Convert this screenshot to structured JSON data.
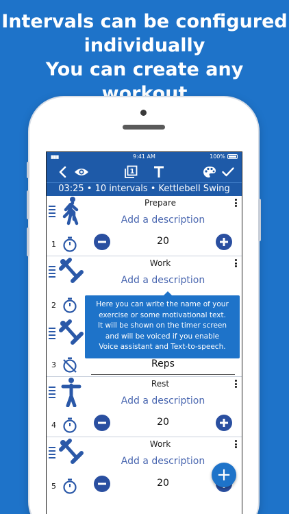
{
  "headline": {
    "line1": "Intervals can be configured",
    "line2": "individually",
    "line3": "You can create any workout"
  },
  "status_bar": {
    "time": "9:41 AM",
    "battery": "100%"
  },
  "toolbar": {
    "icons": [
      "back-icon",
      "eye-icon",
      "copy-one-icon",
      "text-icon",
      "palette-icon",
      "check-icon"
    ],
    "copy_badge": "1"
  },
  "summary": "03:25 • 10 intervals • Kettlebell Swing",
  "intervals": [
    {
      "number": "1",
      "title": "Prepare",
      "description": "Add a description",
      "value": "20",
      "figure": "walking-person-icon",
      "mode": "timer"
    },
    {
      "number": "2",
      "title": "Work",
      "description": "Add a description",
      "value": "",
      "figure": "kettlebell-icon",
      "mode": "timer"
    },
    {
      "number": "3",
      "title": "",
      "description": "",
      "value": "Reps",
      "figure": "kettlebell-icon",
      "mode": "reps"
    },
    {
      "number": "4",
      "title": "Rest",
      "description": "Add a description",
      "value": "20",
      "figure": "standing-person-icon",
      "mode": "timer"
    },
    {
      "number": "5",
      "title": "Work",
      "description": "Add a description",
      "value": "20",
      "figure": "kettlebell-icon",
      "mode": "timer"
    }
  ],
  "tooltip": {
    "line1": "Here you can write the name of your",
    "line2": "exercise or some motivational text.",
    "line3": "It will be shown on the timer screen",
    "line4": "and will be voiced if you enable",
    "line5": "Voice assistant and Text-to-speech."
  },
  "fab_label": "+",
  "colors": {
    "background": "#1e73c9",
    "app_bar": "#1e5aa8",
    "accent": "#2a4fa0"
  }
}
